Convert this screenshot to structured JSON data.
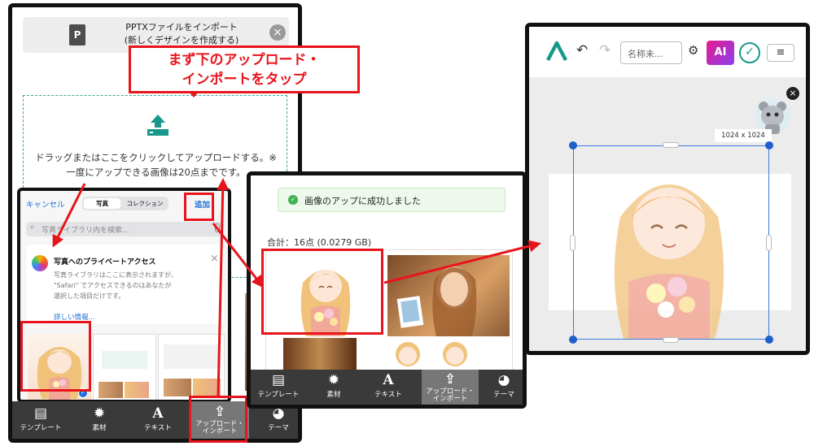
{
  "callout": {
    "line1": "まず下のアップロード・",
    "line2": "インポートをタップ"
  },
  "phone1": {
    "import_line1": "PPTXファイルをインポート",
    "import_line2": "(新しくデザインを作成する)",
    "drop_line1": "ドラッグまたはここをクリックしてアップロードする。※",
    "drop_line2": "一度にアップできる画像は20点までです。",
    "picker": {
      "cancel": "キャンセル",
      "seg_photos": "写真",
      "seg_collection": "コレクション",
      "add": "追加",
      "search_placeholder": "写真ライブラリ内を検索...",
      "privacy_title": "写真へのプライベートアクセス",
      "privacy_line1": "写真ライブラリはここに表示されますが、",
      "privacy_line2": "\"Safari\" でアクセスできるのはあなたが",
      "privacy_line3": "選択した項目だけです。",
      "more_info": "詳しい情報..."
    },
    "toolbar": [
      {
        "icon": "template-icon",
        "glyph": "▤",
        "label": "テンプレート"
      },
      {
        "icon": "material-icon",
        "glyph": "✹",
        "label": "素材"
      },
      {
        "icon": "text-icon",
        "glyph": "A",
        "label": "テキスト"
      },
      {
        "icon": "upload-icon",
        "glyph": "⇪",
        "label1": "アップロード・",
        "label2": "インポート"
      },
      {
        "icon": "theme-icon",
        "glyph": "◕",
        "label": "テーマ"
      }
    ]
  },
  "phone2": {
    "success": "画像のアップに成功しました",
    "total": "合計：16点 (0.0279 GB)",
    "toolbar": [
      {
        "icon": "template-icon",
        "glyph": "▤",
        "label": "テンプレート"
      },
      {
        "icon": "material-icon",
        "glyph": "✹",
        "label": "素材"
      },
      {
        "icon": "text-icon",
        "glyph": "A",
        "label": "テキスト"
      },
      {
        "icon": "upload-icon",
        "glyph": "⇪",
        "label1": "アップロード・",
        "label2": "インポート"
      },
      {
        "icon": "theme-icon",
        "glyph": "◕",
        "label": "テーマ"
      }
    ]
  },
  "phone3": {
    "name_placeholder": "名称未...",
    "ai_label": "AI",
    "dimension": "1024 x 1024"
  },
  "colors": {
    "red": "#e8141c",
    "teal": "#17988a",
    "blue": "#1e6fd9"
  }
}
